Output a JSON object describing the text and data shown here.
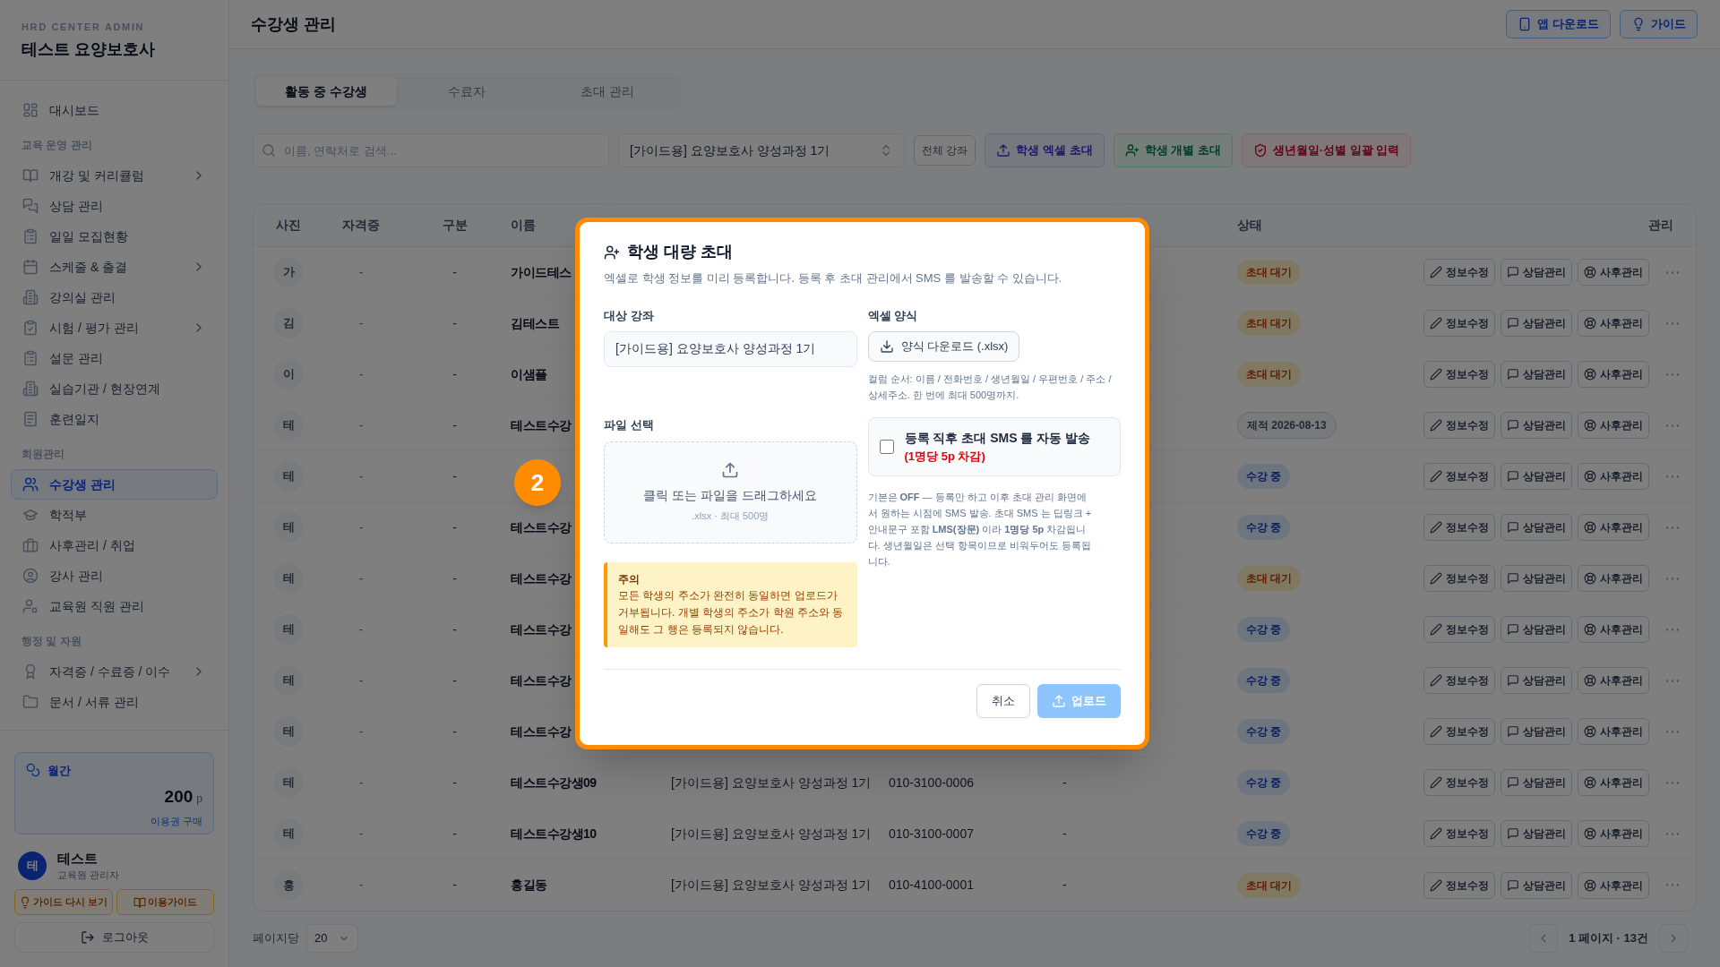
{
  "sidebar": {
    "org": "HRD CENTER ADMIN",
    "title": "테스트 요양보호사",
    "sections": [
      {
        "items": [
          {
            "label": "대시보드",
            "selected": false,
            "has_submenu": false
          }
        ]
      },
      {
        "heading": "교육 운영 관리",
        "items": [
          {
            "label": "개강 및 커리큘럼",
            "selected": false,
            "has_submenu": true
          },
          {
            "label": "상담 관리",
            "selected": false,
            "has_submenu": false
          },
          {
            "label": "일일 모집현황",
            "selected": false,
            "has_submenu": false
          },
          {
            "label": "스케줄 & 출결",
            "selected": false,
            "has_submenu": true
          },
          {
            "label": "강의실 관리",
            "selected": false,
            "has_submenu": false
          },
          {
            "label": "시험 / 평가 관리",
            "selected": false,
            "has_submenu": true
          },
          {
            "label": "설문 관리",
            "selected": false,
            "has_submenu": false
          },
          {
            "label": "실습기관 / 현장연계",
            "selected": false,
            "has_submenu": false
          },
          {
            "label": "훈련일지",
            "selected": false,
            "has_submenu": false
          }
        ]
      },
      {
        "heading": "회원관리",
        "items": [
          {
            "label": "수강생 관리",
            "selected": true,
            "has_submenu": false
          },
          {
            "label": "학적부",
            "selected": false,
            "has_submenu": false
          },
          {
            "label": "사후관리 / 취업",
            "selected": false,
            "has_submenu": false
          },
          {
            "label": "강사 관리",
            "selected": false,
            "has_submenu": false
          },
          {
            "label": "교육원 직원 관리",
            "selected": false,
            "has_submenu": false
          }
        ]
      },
      {
        "heading": "행정 및 자원",
        "items": [
          {
            "label": "자격증 / 수료증 / 이수",
            "selected": false,
            "has_submenu": true
          },
          {
            "label": "문서 / 서류 관리",
            "selected": false,
            "has_submenu": false
          }
        ]
      }
    ],
    "plan": {
      "name": "월간",
      "points": "200",
      "unit": "p",
      "link": "이용권 구매"
    },
    "user": {
      "initial": "테",
      "name": "테스트",
      "role": "교육원 관리자"
    },
    "guide_buttons": [
      "가이드 다시 보기",
      "이용가이드"
    ],
    "logout": "로그아웃"
  },
  "header": {
    "title": "수강생 관리",
    "buttons": [
      "앱 다운로드",
      "가이드"
    ]
  },
  "tabs": [
    {
      "label": "활동 중 수강생",
      "selected": true
    },
    {
      "label": "수료자",
      "selected": false
    },
    {
      "label": "초대 관리",
      "selected": false
    }
  ],
  "toolbar": {
    "search": {
      "placeholder": "이름, 연락처로 검색..."
    },
    "course_select": "[가이드용] 요양보호사 양성과정 1기",
    "all_courses": "전체 강좌",
    "actions": [
      {
        "label": "학생 엑셀 초대",
        "kind": "excel"
      },
      {
        "label": "학생 개별 초대",
        "kind": "single"
      },
      {
        "label": "생년월일·성별 일괄 입력",
        "kind": "bulk"
      }
    ]
  },
  "table": {
    "columns": [
      "사진",
      "자격증",
      "구분",
      "이름",
      "상태",
      "관리"
    ],
    "rows": [
      {
        "initial": "가",
        "certificate": "-",
        "category": "-",
        "name": "가이드테스",
        "status": {
          "label": "초대 대기",
          "kind": "invited"
        },
        "actions": [
          "정보수정",
          "상담관리",
          "사후관리"
        ]
      },
      {
        "initial": "김",
        "certificate": "-",
        "category": "-",
        "name": "김테스트",
        "status": {
          "label": "초대 대기",
          "kind": "invited"
        },
        "actions": [
          "정보수정",
          "상담관리",
          "사후관리"
        ]
      },
      {
        "initial": "이",
        "certificate": "-",
        "category": "-",
        "name": "이샘플",
        "status": {
          "label": "초대 대기",
          "kind": "invited"
        },
        "actions": [
          "정보수정",
          "상담관리",
          "사후관리"
        ]
      },
      {
        "initial": "테",
        "certificate": "-",
        "category": "-",
        "name": "테스트수강",
        "status": {
          "label": "제적 2026-08-13",
          "kind": "expelled"
        },
        "actions": [
          "정보수정",
          "상담관리",
          "사후관리"
        ]
      },
      {
        "initial": "테",
        "certificate": "-",
        "category": "-",
        "status": {
          "label": "수강 중",
          "kind": "active"
        },
        "actions": [
          "정보수정",
          "상담관리",
          "사후관리"
        ]
      },
      {
        "initial": "테",
        "certificate": "-",
        "category": "-",
        "name": "테스트수강",
        "status": {
          "label": "수강 중",
          "kind": "active"
        },
        "actions": [
          "정보수정",
          "상담관리",
          "사후관리"
        ]
      },
      {
        "initial": "테",
        "certificate": "-",
        "category": "-",
        "name": "테스트수강",
        "status": {
          "label": "초대 대기",
          "kind": "invited"
        },
        "actions": [
          "정보수정",
          "상담관리",
          "사후관리"
        ]
      },
      {
        "initial": "테",
        "certificate": "-",
        "category": "-",
        "name": "테스트수강",
        "status": {
          "label": "수강 중",
          "kind": "active"
        },
        "actions": [
          "정보수정",
          "상담관리",
          "사후관리"
        ]
      },
      {
        "initial": "테",
        "certificate": "-",
        "category": "-",
        "name": "테스트수강",
        "status": {
          "label": "수강 중",
          "kind": "active"
        },
        "actions": [
          "정보수정",
          "상담관리",
          "사후관리"
        ]
      },
      {
        "initial": "테",
        "certificate": "-",
        "category": "-",
        "name": "테스트수강",
        "status": {
          "label": "수강 중",
          "kind": "active"
        },
        "actions": [
          "정보수정",
          "상담관리",
          "사후관리"
        ]
      },
      {
        "initial": "테",
        "certificate": "-",
        "category": "-",
        "name": "테스트수강생09",
        "course": "[가이드용] 요양보호사 양성과정 1기",
        "phone": "010-3100-0006",
        "column_7": "-",
        "status": {
          "label": "수강 중",
          "kind": "active"
        },
        "actions": [
          "정보수정",
          "상담관리",
          "사후관리"
        ]
      },
      {
        "initial": "테",
        "certificate": "-",
        "category": "-",
        "name": "테스트수강생10",
        "course": "[가이드용] 요양보호사 양성과정 1기",
        "phone": "010-3100-0007",
        "column_7": "-",
        "status": {
          "label": "수강 중",
          "kind": "active"
        },
        "actions": [
          "정보수정",
          "상담관리",
          "사후관리"
        ]
      },
      {
        "initial": "홍",
        "certificate": "-",
        "category": "-",
        "name": "홍길동",
        "course": "[가이드용] 요양보호사 양성과정 1기",
        "phone": "010-4100-0001",
        "column_7": "-",
        "status": {
          "label": "초대 대기",
          "kind": "invited"
        },
        "actions": [
          "정보수정",
          "상담관리",
          "사후관리"
        ]
      }
    ]
  },
  "pagination": {
    "per_page_label": "페이지당",
    "per_page": "20",
    "summary": "1 페이지 · 13건"
  },
  "modal": {
    "title": "학생 대량 초대",
    "description": "엑셀로 학생 정보를 미리 등록합니다. 등록 후 초대 관리에서 SMS 를 발송할 수 있습니다.",
    "course_label": "대상 강좌",
    "course_value": "[가이드용] 요양보호사 양성과정 1기",
    "template_label": "엑셀 양식",
    "template_button": "양식 다운로드 (.xlsx)",
    "template_hint": "컬럼 순서: 이름 / 전화번호 / 생년월일 / 우편번호 / 주소 / 상세주소. 한 번에 최대 500명까지.",
    "file_label": "파일 선택",
    "dropzone": {
      "text": "클릭 또는 파일을 드래그하세요",
      "hint": ".xlsx · 최대 500명"
    },
    "warning": {
      "title": "주의",
      "text": "모든 학생의 주소가 완전히 동일하면 업로드가 거부됩니다. 개별 학생의 주소가 학원 주소와 동일해도 그 행은 등록되지 않습니다."
    },
    "auto_sms": {
      "label": "등록 직후 초대 SMS 를 자동 발송",
      "cost": "(1명당 5p 차감)",
      "checked": false
    },
    "sms_note": "기본은 **OFF** — 등록만 하고 이후 초대 관리 화면에서 원하는 시점에 SMS 발송. 초대 SMS 는 딥링크 + 안내문구 포함 **LMS(장문)** 이라 **1명당 5p** 차감됩니다. 생년월일은 선택 항목이므로 비워두어도 등록됩니다.",
    "cancel": "취소",
    "upload": {
      "label": "업로드",
      "disabled": true
    }
  },
  "step_badge": "2"
}
